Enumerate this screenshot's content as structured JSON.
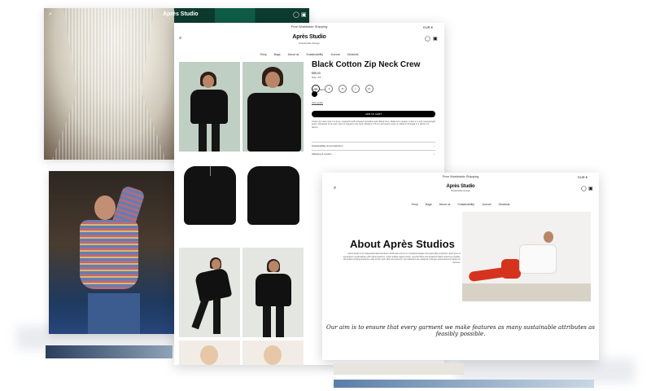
{
  "back_window": {
    "logo": "Après Studio",
    "icons": [
      "search-icon",
      "account-icon",
      "cart-icon"
    ]
  },
  "product": {
    "announcement": "Free Worldwide Shipping",
    "currency": "EUR €",
    "logo": "Après Studio",
    "logo_sub": "Sustainable Design",
    "nav": [
      "Shop",
      "Bags",
      "About us",
      "Sustainability",
      "Journal",
      "Stockists"
    ],
    "title": "Black Cotton Zip Neck Crew",
    "price": "€85,00",
    "size_label": "Size: XS",
    "sizes": [
      "XS",
      "S",
      "M",
      "L",
      "XL"
    ],
    "selected_size": "XS",
    "color_label": "Color: Black",
    "size_guide": "Size guide",
    "add_to_cart": "ADD TO CART",
    "description": "Cotton zip neck crew in a boxy, cropped fit with dropped shoulders and ribbed trims. Made from organic cotton in a soft, heavyweight jersey. Designed to be worn open or zipped to the neck. Model is 175 cm and wears a size S. Made in Portugal in a family-run factory.",
    "accordions": [
      "Sustainability and production",
      "Shipping & returns"
    ],
    "colors": {
      "accent": "#000000",
      "text": "#111111"
    }
  },
  "about": {
    "announcement": "Free Worldwide Shipping",
    "currency": "EUR €",
    "logo": "Après Studio",
    "logo_sub": "Sustainable Design",
    "nav": [
      "Shop",
      "Bags",
      "About us",
      "Sustainability",
      "Journal",
      "Stockists"
    ],
    "title": "About Après Studios",
    "body": "Après Studio is an independent label founded in 2019 with a focus on considered design and responsible production. Each piece is developed in small batches with trusted partners, using certified organic cotton, recycled fibres and deadstock fabrics wherever possible. We believe clothing should be made to last, worn often and cared for. Our collections are designed in Europe and produced in family-run factories.",
    "quote": "Our aim is to ensure that every garment we make features as many sustainable attributes as feasibly possible."
  }
}
